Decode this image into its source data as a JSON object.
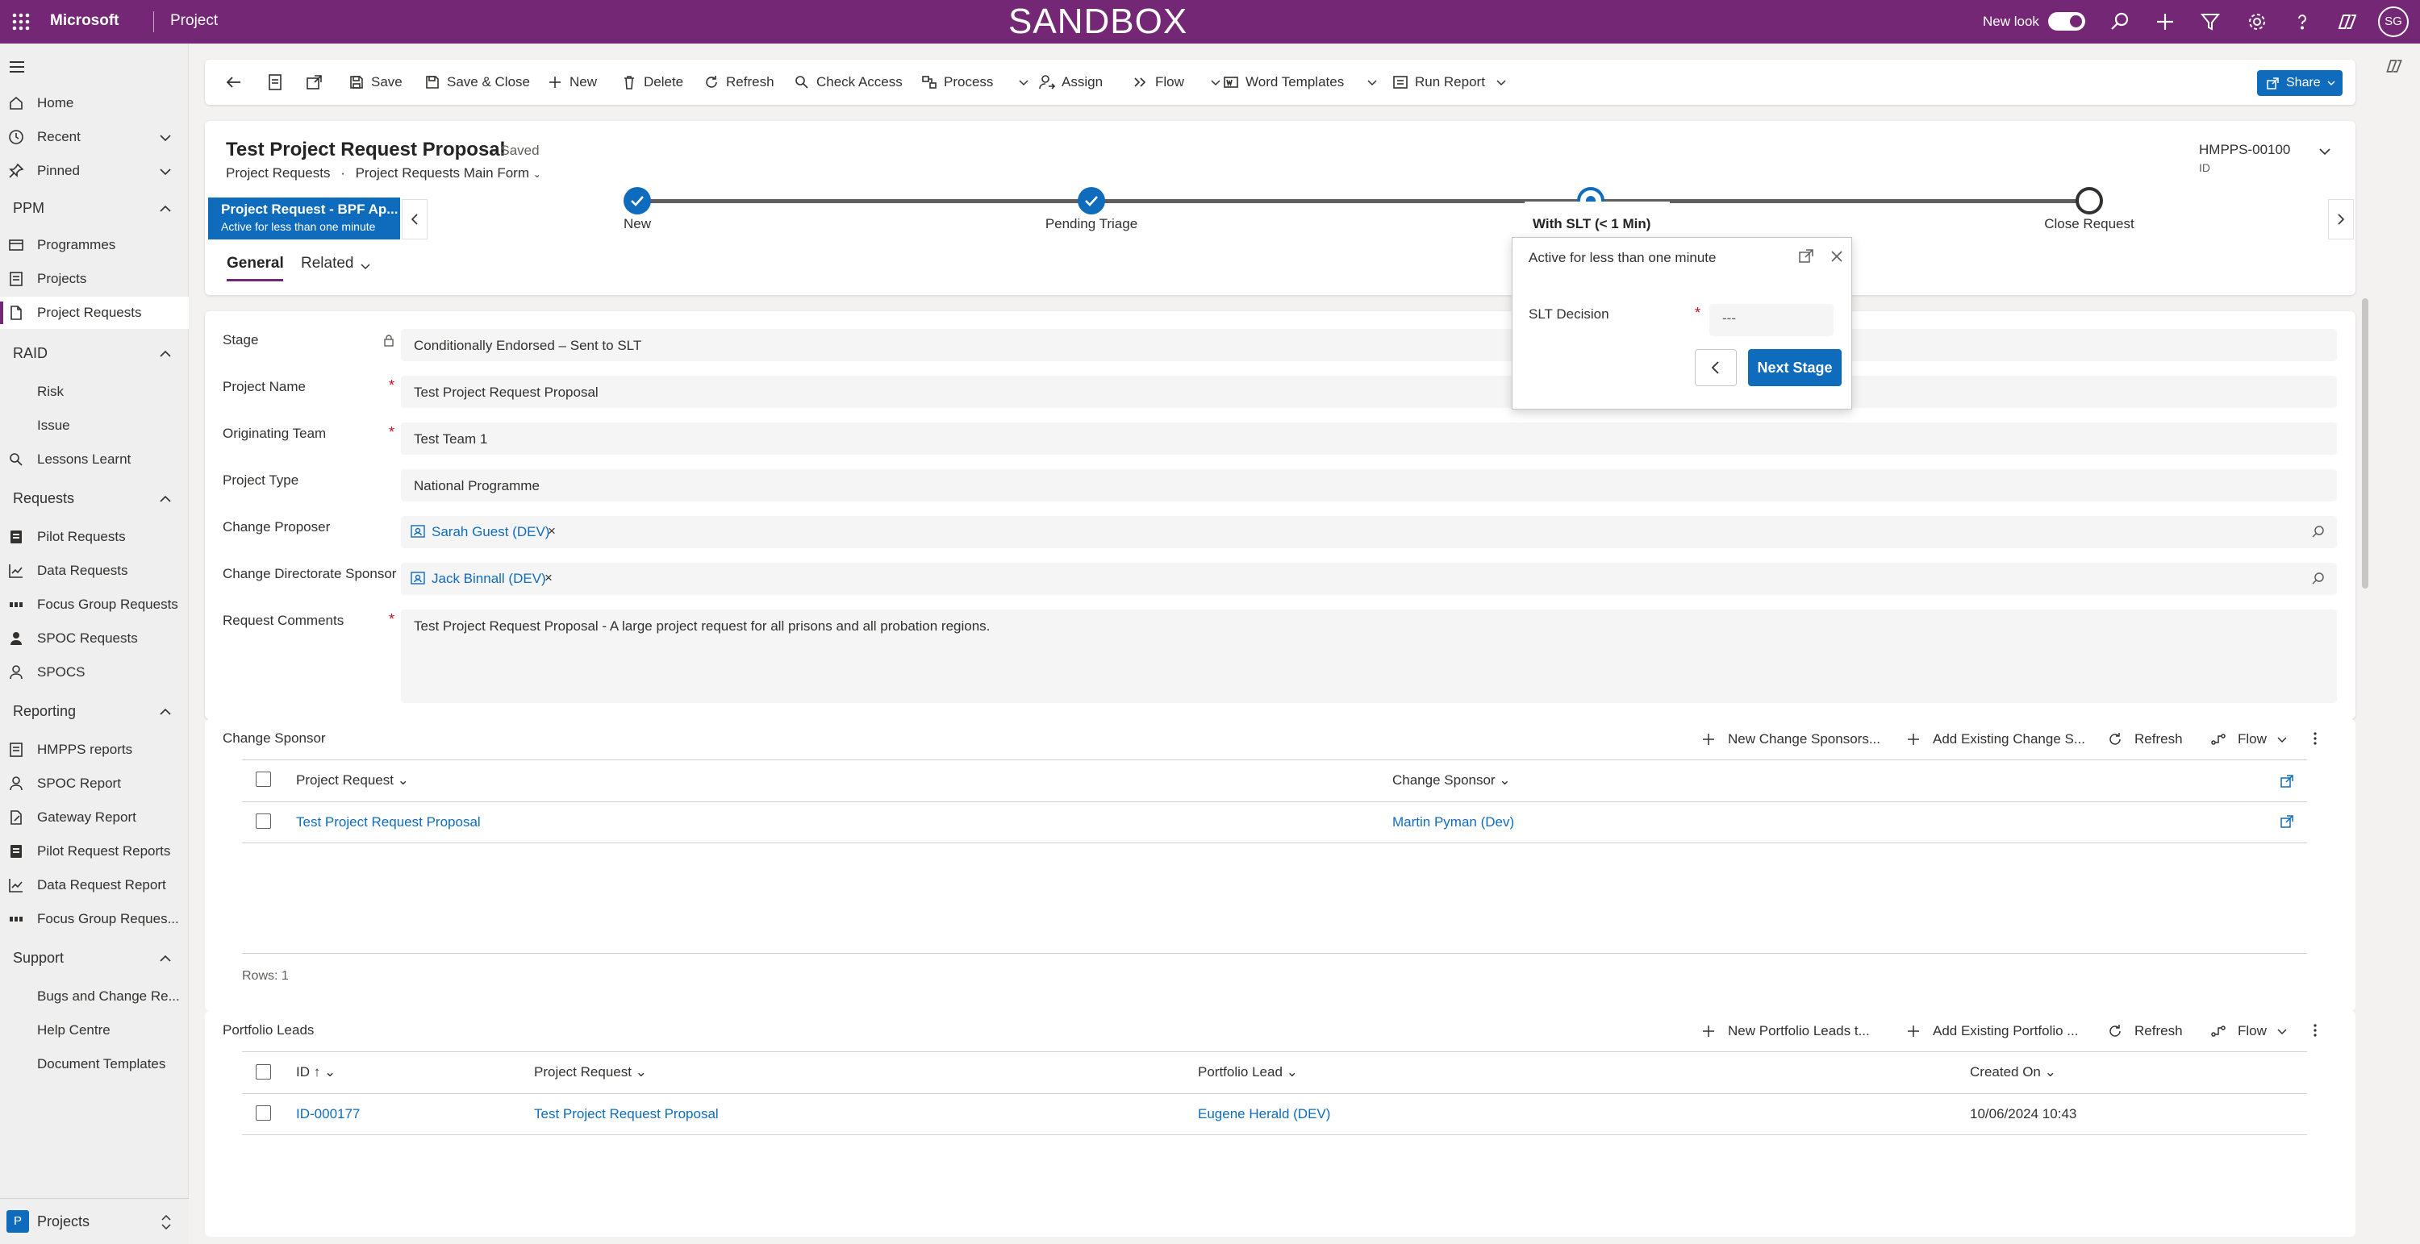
{
  "topbar": {
    "brand": "Microsoft",
    "app": "Project",
    "environment": "SANDBOX",
    "new_look_label": "New look",
    "avatar_initials": "SG"
  },
  "sidebar": {
    "items": [
      {
        "label": "Home",
        "icon": "home-icon"
      },
      {
        "label": "Recent",
        "icon": "clock-icon"
      },
      {
        "label": "Pinned",
        "icon": "pin-icon"
      }
    ],
    "groups": [
      {
        "label": "PPM",
        "items": [
          "Programmes",
          "Projects",
          "Project Requests"
        ]
      },
      {
        "label": "RAID",
        "items": [
          "Risk",
          "Issue",
          "Lessons Learnt"
        ]
      },
      {
        "label": "Requests",
        "items": [
          "Pilot Requests",
          "Data Requests",
          "Focus Group Requests",
          "SPOC Requests",
          "SPOCS"
        ]
      },
      {
        "label": "Reporting",
        "items": [
          "HMPPS reports",
          "SPOC Report",
          "Gateway Report",
          "Pilot Request Reports",
          "Data Request Report",
          "Focus Group Reques..."
        ]
      },
      {
        "label": "Support",
        "items": [
          "Bugs and Change Re...",
          "Help Centre",
          "Document Templates"
        ]
      }
    ],
    "area": {
      "badge": "P",
      "label": "Projects"
    }
  },
  "commands": [
    "Save",
    "Save & Close",
    "New",
    "Delete",
    "Refresh",
    "Check Access",
    "Process",
    "Assign",
    "Flow",
    "Word Templates",
    "Run Report"
  ],
  "share_label": "Share",
  "header": {
    "title": "Test Project Request Proposal",
    "saved": "- Saved",
    "entity": "Project Requests",
    "form": "Project Requests Main Form",
    "record_id": "HMPPS-00100",
    "record_id_label": "ID"
  },
  "bpf": {
    "name": "Project Request - BPF Ap...",
    "active": "Active for less than one minute",
    "stages": [
      {
        "label": "New",
        "state": "done"
      },
      {
        "label": "Pending Triage",
        "state": "done"
      },
      {
        "label": "With SLT",
        "duration": "(< 1 Min)",
        "state": "active"
      },
      {
        "label": "Close Request",
        "state": "todo"
      }
    ]
  },
  "tabs": [
    "General",
    "Related"
  ],
  "fields": [
    {
      "label": "Stage",
      "value": "Conditionally Endorsed – Sent to SLT",
      "locked": true
    },
    {
      "label": "Project Name",
      "value": "Test Project Request Proposal",
      "required": true
    },
    {
      "label": "Originating Team",
      "value": "Test Team 1",
      "required": true
    },
    {
      "label": "Project Type",
      "value": "National Programme"
    },
    {
      "label": "Change Proposer",
      "lookup": "Sarah Guest (DEV)"
    },
    {
      "label": "Change Directorate Sponsor",
      "lookup": "Jack Binnall (DEV)"
    },
    {
      "label": "Request Comments",
      "value": "Test Project Request Proposal - A large project request for all prisons and all probation regions.",
      "required": true
    }
  ],
  "change_sponsor": {
    "title": "Change Sponsor",
    "commands": [
      "New Change Sponsors...",
      "Add Existing Change S...",
      "Refresh",
      "Flow"
    ],
    "columns": [
      "Project Request",
      "Change Sponsor"
    ],
    "rows": [
      [
        "Test Project Request Proposal",
        "Martin Pyman (Dev)"
      ]
    ],
    "footer": "Rows: 1"
  },
  "portfolio_leads": {
    "title": "Portfolio Leads",
    "commands": [
      "New Portfolio Leads t...",
      "Add Existing Portfolio ...",
      "Refresh",
      "Flow"
    ],
    "columns": [
      "ID ↑",
      "Project Request",
      "Portfolio Lead",
      "Created On"
    ],
    "rows": [
      [
        "ID-000177",
        "Test Project Request Proposal",
        "Eugene Herald (DEV)",
        "10/06/2024 10:43"
      ]
    ]
  },
  "flyout": {
    "active": "Active for less than one minute",
    "field_label": "SLT Decision",
    "field_value": "---",
    "next_label": "Next Stage"
  },
  "colors": {
    "brand": "#742774",
    "accent": "#0f6cbd"
  }
}
